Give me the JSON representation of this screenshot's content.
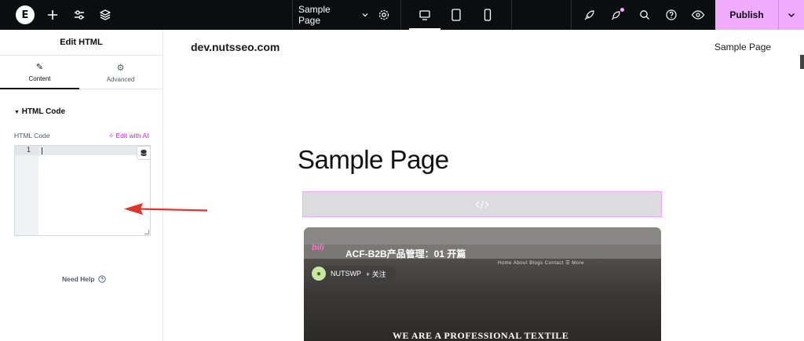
{
  "topbar": {
    "logo": "E",
    "page_title": "Sample Page",
    "publish_label": "Publish",
    "colors": {
      "bar": "#0c0d0e",
      "accent": "#f0abfc"
    }
  },
  "panel": {
    "title": "Edit HTML",
    "tabs": [
      {
        "label": "Content",
        "icon": "pencil-icon"
      },
      {
        "label": "Advanced",
        "icon": "gear-icon"
      }
    ],
    "section_title": "HTML Code",
    "field_label": "HTML Code",
    "ai_link": "Edit with AI",
    "line_number": "1",
    "need_help": "Need Help"
  },
  "canvas": {
    "site_title": "dev.nutsseo.com",
    "site_menu_item": "Sample Page",
    "heading": "Sample Page",
    "video": {
      "logo_text": "bili",
      "title": "ACF-B2B产品管理：01 开篇",
      "channel": "NUTSWP",
      "follow": "+ 关注",
      "nav_text": "Home   About   Blogs   Contact   ☰ More",
      "banner_text": "WE ARE A PROFESSIONAL TEXTILE"
    }
  }
}
